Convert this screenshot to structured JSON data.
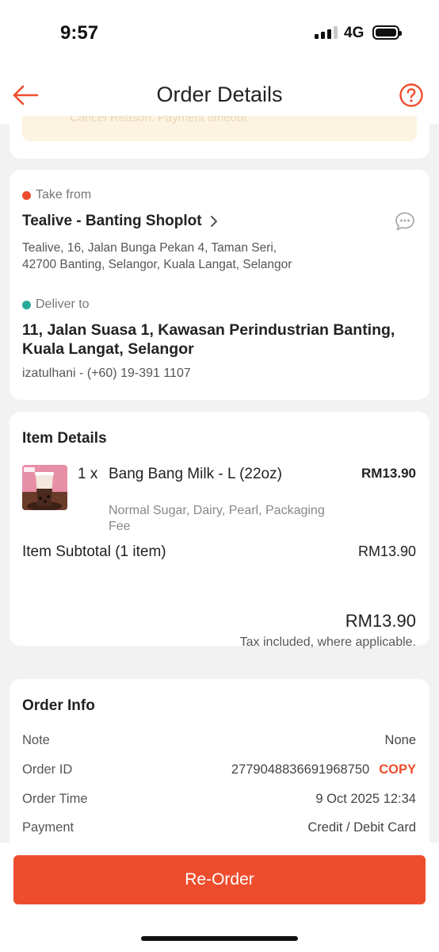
{
  "status_bar": {
    "time": "9:57",
    "network": "4G"
  },
  "header": {
    "title": "Order Details"
  },
  "status_card": {
    "text": "Cancel Reason: Payment timeout"
  },
  "pickup": {
    "label": "Take from",
    "shop_name": "Tealive - Banting Shoplot",
    "address_line1": "Tealive, 16, Jalan Bunga Pekan 4, Taman Seri,",
    "address_line2": "42700 Banting, Selangor, Kuala Langat, Selangor"
  },
  "delivery": {
    "label": "Deliver to",
    "address_line1": "11, Jalan Suasa 1, Kawasan Perindustrian Banting,",
    "address_line2": "Kuala Langat, Selangor",
    "contact": "izatulhani - (+60) 19-391 1107"
  },
  "items": {
    "title": "Item Details",
    "list": [
      {
        "qty": "1 x",
        "name": "Bang Bang Milk - L (22oz)",
        "price": "RM13.90",
        "options_line1": "Normal Sugar, Dairy, Pearl, Packaging",
        "options_line2": "Fee"
      }
    ],
    "subtotal_label": "Item Subtotal (1 item)",
    "subtotal_value": "RM13.90",
    "total": "RM13.90",
    "tax_note": "Tax included, where applicable."
  },
  "order_info": {
    "title": "Order Info",
    "note_label": "Note",
    "note_value": "None",
    "order_id_label": "Order ID",
    "order_id_value": "2779048836691968750",
    "copy_label": "COPY",
    "time_label": "Order Time",
    "time_value": "9 Oct 2025 12:34",
    "payment_label": "Payment",
    "payment_value": "Credit / Debit Card"
  },
  "actions": {
    "reorder_label": "Re-Order"
  },
  "colors": {
    "accent": "#ee4d2d",
    "pickup_dot": "#ee4d2d",
    "delivery_dot": "#26aa99"
  }
}
